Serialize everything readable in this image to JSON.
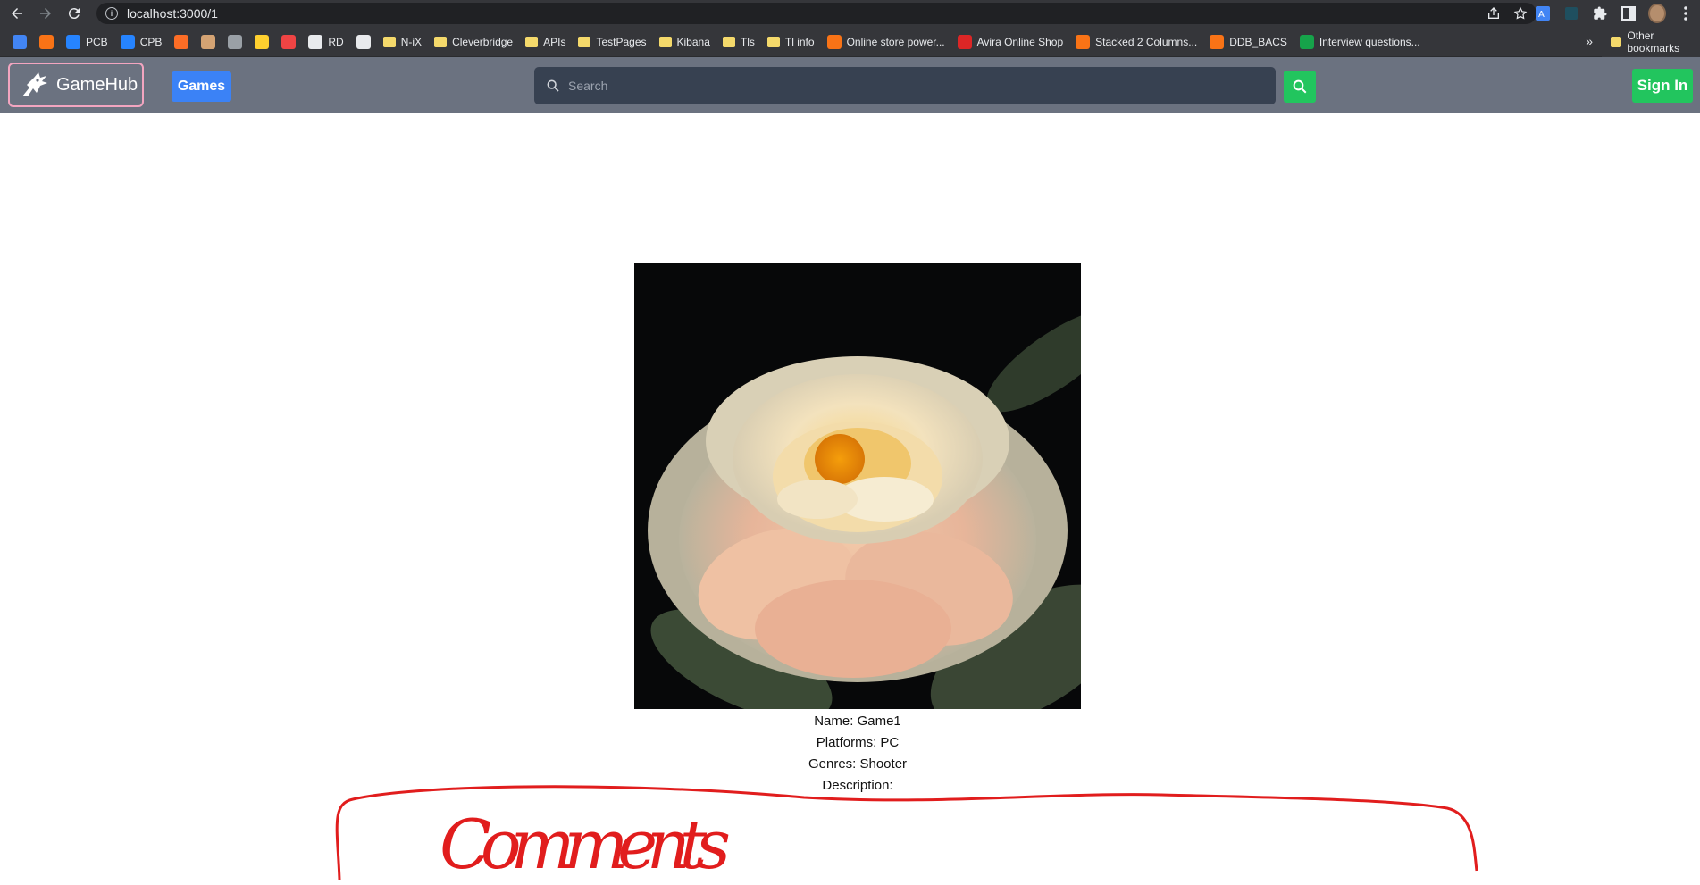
{
  "browser": {
    "url": "localhost:3000/1",
    "bookmarks": [
      {
        "label": "",
        "icon": "calendar-icon",
        "color": "#4285f4"
      },
      {
        "label": "",
        "icon": "box-icon",
        "color": "#f97316"
      },
      {
        "label": "PCB",
        "icon": "jira-icon",
        "color": "#2684ff"
      },
      {
        "label": "CPB",
        "icon": "jira-icon",
        "color": "#2684ff"
      },
      {
        "label": "",
        "icon": "gitlab-icon",
        "color": "#fc6d26"
      },
      {
        "label": "",
        "icon": "person-icon",
        "color": "#d4a373"
      },
      {
        "label": "",
        "icon": "globe-icon",
        "color": "#9aa0a6"
      },
      {
        "label": "",
        "icon": "miro-icon",
        "color": "#ffd02f"
      },
      {
        "label": "",
        "icon": "dots-icon",
        "color": "#ef4444"
      },
      {
        "label": "RD",
        "icon": "globe-icon",
        "color": "#e8eaed"
      },
      {
        "label": "",
        "icon": "gear-icon",
        "color": "#e8eaed"
      },
      {
        "label": "N-iX",
        "icon": "folder-icon",
        "color": "#f4d96b"
      },
      {
        "label": "Cleverbridge",
        "icon": "folder-icon",
        "color": "#f4d96b"
      },
      {
        "label": "APIs",
        "icon": "folder-icon",
        "color": "#f4d96b"
      },
      {
        "label": "TestPages",
        "icon": "folder-icon",
        "color": "#f4d96b"
      },
      {
        "label": "Kibana",
        "icon": "folder-icon",
        "color": "#f4d96b"
      },
      {
        "label": "Tls",
        "icon": "folder-icon",
        "color": "#f4d96b"
      },
      {
        "label": "Tl info",
        "icon": "folder-icon",
        "color": "#f4d96b"
      },
      {
        "label": "Online store power...",
        "icon": "swirl-icon",
        "color": "#f97316"
      },
      {
        "label": "Avira Online Shop",
        "icon": "avira-icon",
        "color": "#dc2626"
      },
      {
        "label": "Stacked 2 Columns...",
        "icon": "swirl-icon",
        "color": "#f97316"
      },
      {
        "label": "DDB_BACS",
        "icon": "swirl-icon",
        "color": "#f97316"
      },
      {
        "label": "Interview questions...",
        "icon": "sheets-icon",
        "color": "#16a34a"
      }
    ],
    "more_label": "»",
    "other_bookmarks": "Other bookmarks"
  },
  "navbar": {
    "brand": "GameHub",
    "games_label": "Games",
    "search_placeholder": "Search",
    "signin_label": "Sign In"
  },
  "game": {
    "image": "flower-image",
    "name_line": "Name: Game1",
    "platforms_line": "Platforms: PC",
    "genres_line": "Genres: Shooter",
    "description_line": "Description:"
  },
  "annotation": {
    "text": "Comments",
    "color": "#e11d1d"
  },
  "colors": {
    "navbar_bg": "#6b7280",
    "games_btn": "#3b82f6",
    "success_green": "#22c55e",
    "search_bg": "#374151",
    "brand_border": "#f3a5c0"
  }
}
